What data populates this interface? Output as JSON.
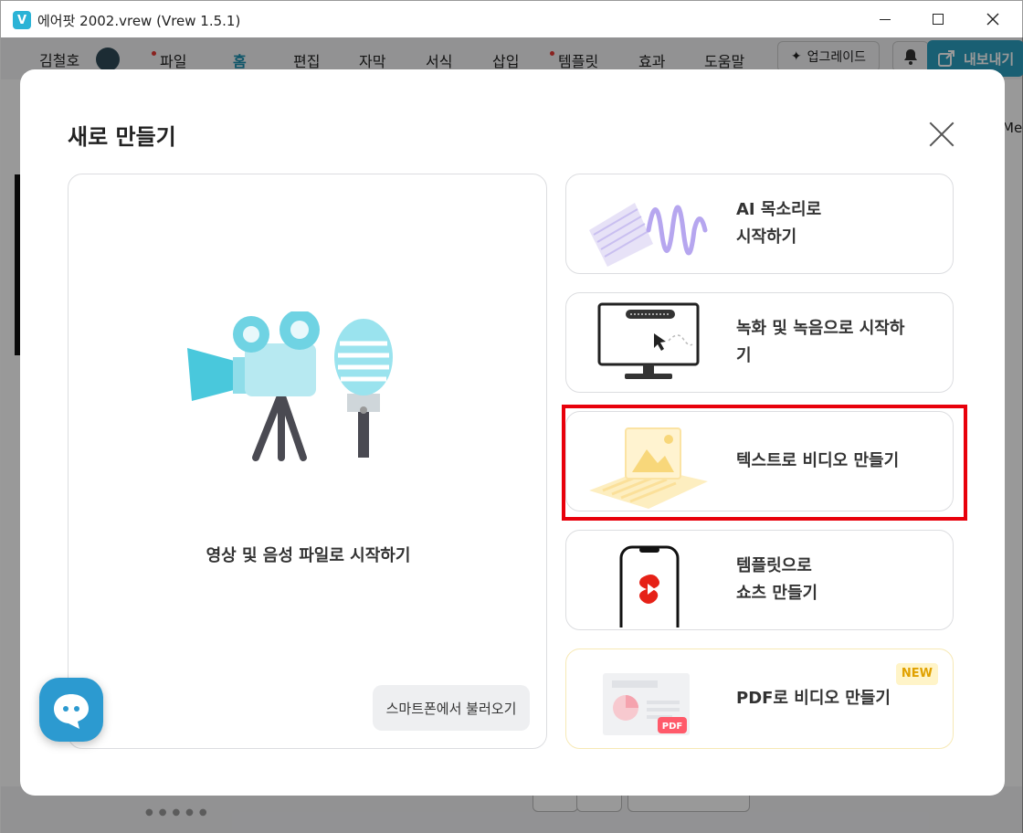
{
  "window": {
    "title": "에어팟 2002.vrew (Vrew 1.5.1)",
    "app_icon": "V"
  },
  "menubar": {
    "user": "김철호",
    "items": [
      {
        "label": "파일",
        "dot": true
      },
      {
        "label": "홈",
        "active": true
      },
      {
        "label": "편집"
      },
      {
        "label": "자막"
      },
      {
        "label": "서식"
      },
      {
        "label": "삽입"
      },
      {
        "label": "템플릿",
        "dot": true
      },
      {
        "label": "효과"
      },
      {
        "label": "도움말"
      }
    ],
    "upgrade_label": "업그레이드",
    "export_label": "내보내기"
  },
  "background": {
    "right_text": "Me"
  },
  "modal": {
    "title": "새로 만들기",
    "main_option": {
      "label": "영상 및 음성 파일로 시작하기",
      "phone_button": "스마트폰에서 불러오기"
    },
    "options": [
      {
        "line1": "AI 목소리로",
        "line2": "시작하기"
      },
      {
        "line1": "녹화 및 녹음으로 시작하",
        "line2": "기"
      },
      {
        "line1": "텍스트로 비디오 만들기",
        "line2": ""
      },
      {
        "line1": "템플릿으로",
        "line2": "쇼츠 만들기"
      },
      {
        "line1": "PDF로 비디오 만들기",
        "line2": "",
        "badge": "NEW",
        "illus_label": "PDF"
      }
    ]
  },
  "colors": {
    "accent": "#2a9fc0",
    "highlight": "#e8000b",
    "new_badge_text": "#e0a100"
  }
}
